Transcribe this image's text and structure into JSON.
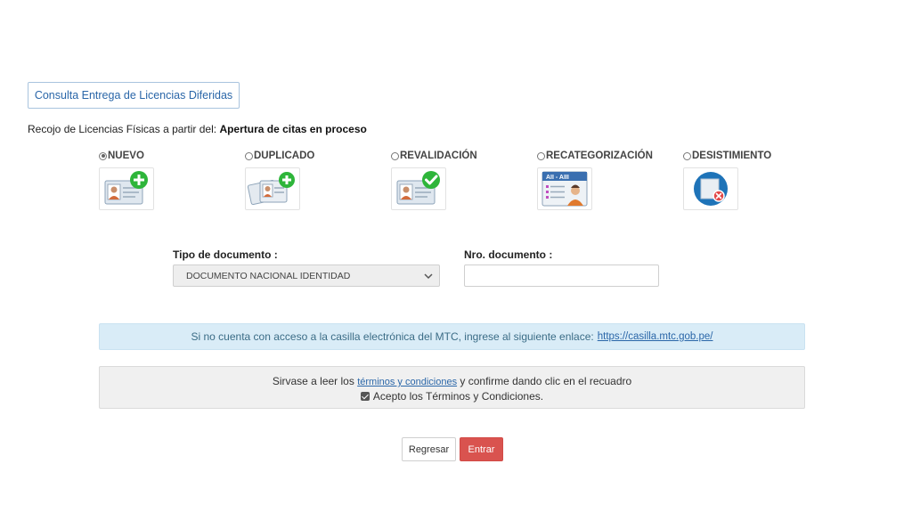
{
  "header": {
    "consulta_button": "Consulta Entrega de Licencias Diferidas"
  },
  "recojo": {
    "prefix": "Recojo de Licencias Físicas a partir del: ",
    "value": "Apertura de citas en proceso"
  },
  "options": [
    {
      "label": "NUEVO",
      "selected": true,
      "icon": "license-add-icon"
    },
    {
      "label": "DUPLICADO",
      "selected": false,
      "icon": "license-duplicate-icon"
    },
    {
      "label": "REVALIDACIÓN",
      "selected": false,
      "icon": "license-check-icon"
    },
    {
      "label": "RECATEGORIZACIÓN",
      "selected": false,
      "icon": "license-categories-icon"
    },
    {
      "label": "DESISTIMIENTO",
      "selected": false,
      "icon": "license-cancel-icon"
    }
  ],
  "form": {
    "tipo_label": "Tipo de documento :",
    "tipo_value": "DOCUMENTO NACIONAL IDENTIDAD",
    "nro_label": "Nro. documento :",
    "nro_value": ""
  },
  "info": {
    "text": "Si no cuenta con acceso a la casilla electrónica del MTC, ingrese al siguiente enlace:",
    "link": "https://casilla.mtc.gob.pe/"
  },
  "terms": {
    "before": "Sirvase a leer los ",
    "link": "términos y condiciones",
    "after": " y confirme dando clic en el recuadro",
    "checkbox_label": "Acepto los Términos y Condiciones.",
    "checked": true
  },
  "actions": {
    "back": "Regresar",
    "submit": "Entrar"
  },
  "colors": {
    "accent": "#2a66a8",
    "info_bg": "#d9ecf7",
    "danger": "#d9534f",
    "green": "#2eb53a"
  }
}
